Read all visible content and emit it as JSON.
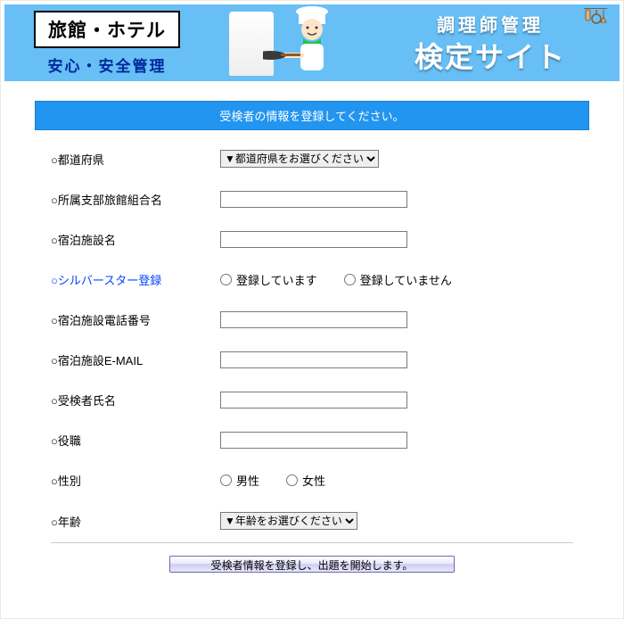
{
  "banner": {
    "left_box1": "旅館・ホテル",
    "left_box2": "安心・安全管理",
    "right_line1": "調理師管理",
    "right_line2": "検定サイト"
  },
  "form": {
    "header": "受検者の情報を登録してください。",
    "prefecture": {
      "label": "○都道府県",
      "selected": "▼都道府県をお選びください"
    },
    "branch_union": {
      "label": "○所属支部旅館組合名",
      "value": ""
    },
    "facility_name": {
      "label": "○宿泊施設名",
      "value": ""
    },
    "silver_star": {
      "label": "○シルバースター登録",
      "option_yes": "登録しています",
      "option_no": "登録していません"
    },
    "facility_phone": {
      "label": "○宿泊施設電話番号",
      "value": ""
    },
    "facility_email": {
      "label": "○宿泊施設E-MAIL",
      "value": ""
    },
    "examinee_name": {
      "label": "○受検者氏名",
      "value": ""
    },
    "position": {
      "label": "○役職",
      "value": ""
    },
    "gender": {
      "label": "○性別",
      "option_male": "男性",
      "option_female": "女性"
    },
    "age": {
      "label": "○年齢",
      "selected": "▼年齢をお選びください"
    },
    "submit_label": "受検者情報を登録し、出題を開始します。"
  }
}
